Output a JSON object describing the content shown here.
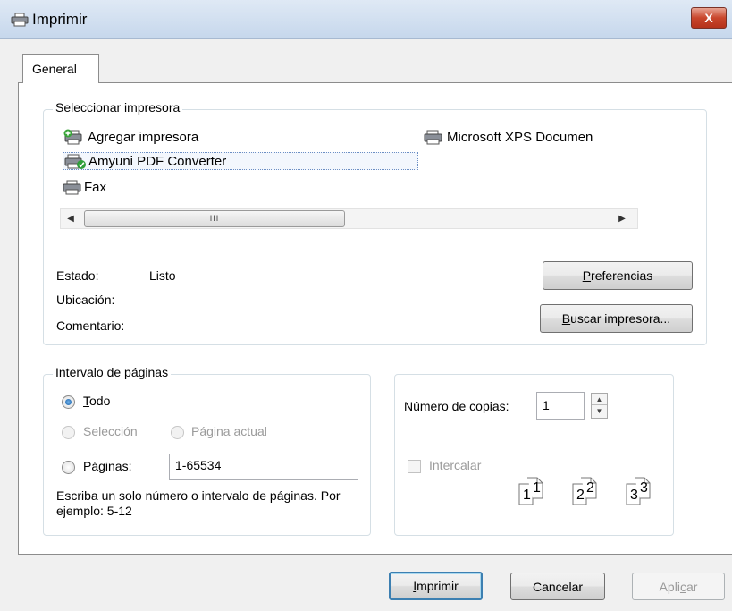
{
  "window": {
    "title": "Imprimir",
    "close_label": "X",
    "accent": "#c9462c"
  },
  "tabs": [
    {
      "label": "General",
      "selected": true
    }
  ],
  "printer_group": {
    "label": "Seleccionar impresora",
    "printers": [
      {
        "label": "Agregar impresora",
        "icon": "add-printer-icon"
      },
      {
        "label": "Amyuni PDF Converter",
        "icon": "default-printer-icon",
        "selected": true
      },
      {
        "label": "Fax",
        "icon": "fax-icon"
      },
      {
        "label": "Microsoft XPS Documen",
        "icon": "printer-icon"
      }
    ],
    "scrollbar_grip": "III",
    "status_label": "Estado:",
    "status_value": "Listo",
    "location_label": "Ubicación:",
    "location_value": "",
    "comment_label": "Comentario:",
    "comment_value": "",
    "preferences_button": {
      "pre": "",
      "key": "P",
      "post": "referencias"
    },
    "find_printer_button": {
      "pre": "",
      "key": "B",
      "post": "uscar impresora..."
    }
  },
  "page_range": {
    "label": "Intervalo de páginas",
    "all": {
      "pre": "",
      "key": "T",
      "post": "odo",
      "checked": true
    },
    "selection": {
      "pre": "",
      "key": "S",
      "post": "elección",
      "enabled": false
    },
    "current_page": {
      "pre": "Página act",
      "key": "u",
      "post": "al",
      "enabled": false
    },
    "pages": {
      "label": "Páginas:",
      "value": "1-65534"
    },
    "hint": "Escriba un solo número o intervalo de páginas. Por ejemplo: 5-12"
  },
  "copies": {
    "label": {
      "pre": "Número de c",
      "key": "o",
      "post": "pias:"
    },
    "value": "1",
    "collate": {
      "pre": "",
      "key": "I",
      "post": "ntercalar",
      "checked": false,
      "enabled": false
    },
    "collate_pages": [
      "1",
      "1",
      "2",
      "2",
      "3",
      "3"
    ]
  },
  "footer": {
    "print_button": {
      "pre": "",
      "key": "I",
      "post": "mprimir"
    },
    "cancel_button": "Cancelar",
    "apply_button": {
      "pre": "Apli",
      "key": "c",
      "post": "ar"
    }
  }
}
